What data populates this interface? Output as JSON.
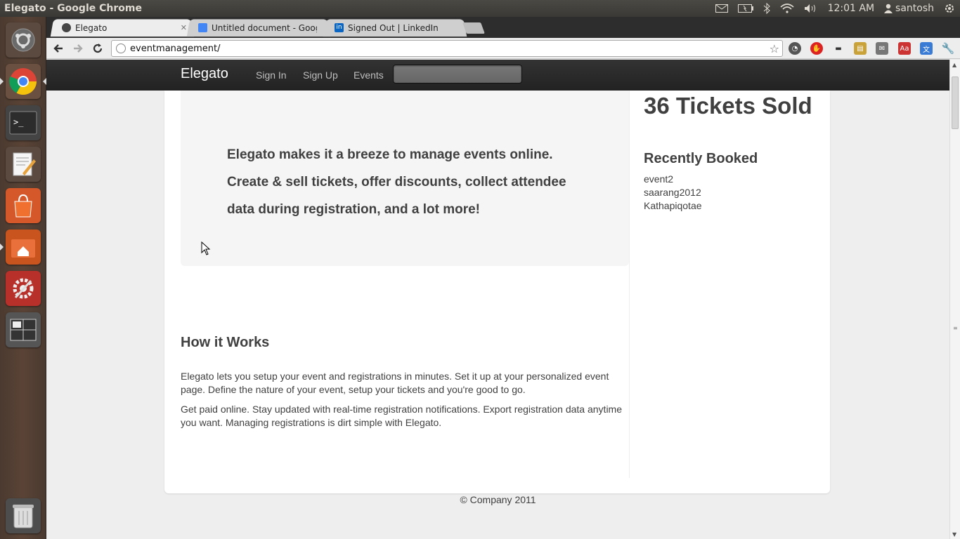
{
  "os_panel": {
    "window_title": "Elegato - Google Chrome",
    "clock": "12:01 AM",
    "user": "santosh",
    "icons": [
      "mail-icon",
      "battery-icon",
      "bluetooth-icon",
      "wifi-icon",
      "volume-icon",
      "user-icon",
      "power-gear-icon"
    ]
  },
  "launcher": {
    "items": [
      "ubuntu-dash-icon",
      "chrome-icon",
      "terminal-icon",
      "text-editor-icon",
      "software-center-icon",
      "home-folder-icon",
      "system-settings-icon",
      "workspace-switcher-icon",
      "trash-icon"
    ]
  },
  "browser": {
    "tabs": [
      {
        "label": "Elegato",
        "active": true
      },
      {
        "label": "Untitled document - Goog",
        "active": false
      },
      {
        "label": "Signed Out | LinkedIn",
        "active": false
      }
    ],
    "url": "eventmanagement/"
  },
  "site": {
    "brand": "Elegato",
    "nav": {
      "sign_in": "Sign In",
      "sign_up": "Sign Up",
      "events": "Events"
    },
    "hero_text": "Elegato makes it a breeze to manage events online. Create & sell tickets, offer discounts, collect attendee data during registration, and a lot more!",
    "tickets_sold": "36 Tickets Sold",
    "recently_booked_title": "Recently Booked",
    "recently_booked": [
      "event2",
      "saarang2012",
      "Kathapiqotae"
    ],
    "how_title": "How it Works",
    "how_p1": "Elegato lets you setup your event and registrations in minutes. Set it up at your personalized event page. Define the nature of your event, setup your tickets and you're good to go.",
    "how_p2": "Get paid online. Stay updated with real-time registration notifications. Export registration data anytime you want. Managing registrations is dirt simple with Elegato.",
    "footer": "© Company 2011"
  }
}
